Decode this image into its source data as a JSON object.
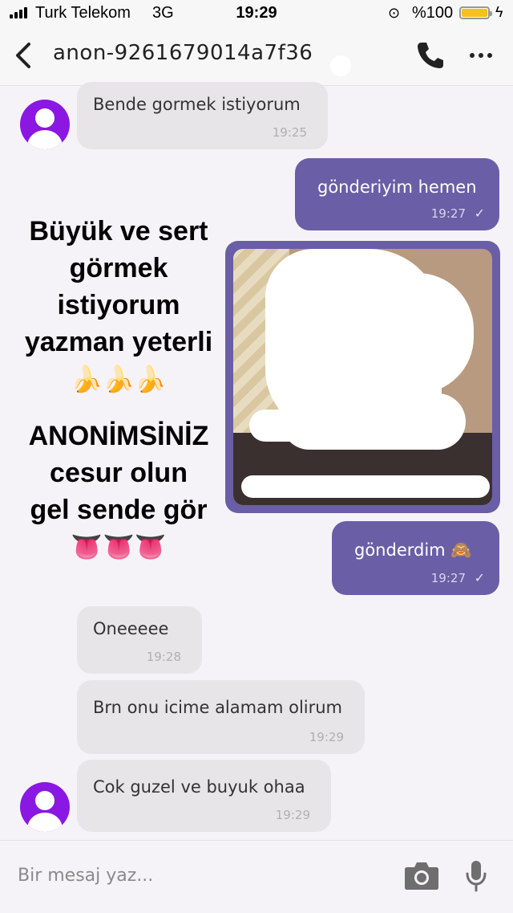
{
  "status_bar": {
    "carrier": "Turk Telekom",
    "network": "3G",
    "time": "19:29",
    "battery": "%100",
    "battery_color": "#f4c31a"
  },
  "header": {
    "title": "anon-9261679014a7f36",
    "back_icon": "chevron-left-icon",
    "call_icon": "phone-icon",
    "more_icon": "more-icon"
  },
  "messages": [
    {
      "direction": "in",
      "text": "Bende gormek istiyorum",
      "time": "19:25"
    },
    {
      "direction": "out",
      "text": "gönderiyim hemen",
      "time": "19:27"
    },
    {
      "direction": "out",
      "type": "image"
    },
    {
      "direction": "out",
      "text": "gönderdim 🙈",
      "time": "19:27"
    },
    {
      "direction": "in",
      "text": "Oneeeee",
      "time": "19:28"
    },
    {
      "direction": "in",
      "text": "Brn onu icime alamam olirum",
      "time": "19:29"
    },
    {
      "direction": "in",
      "text": "Cok guzel ve buyuk ohaa",
      "time": "19:29"
    }
  ],
  "overlay_text": {
    "line1": "Büyük ve sert",
    "line2": "görmek",
    "line3": "istiyorum",
    "line4": "yazman yeterli",
    "emoji1": "🍌🍌🍌",
    "line5": "ANONİMSİNİZ",
    "line6": "cesur olun",
    "line7": "gel sende gör",
    "emoji2": "👅👅👅"
  },
  "input": {
    "placeholder": "Bir mesaj yaz..."
  },
  "colors": {
    "outgoing_bubble": "#6a5fa6",
    "incoming_bubble": "#e7e5e8",
    "avatar": "#8b17e3"
  }
}
